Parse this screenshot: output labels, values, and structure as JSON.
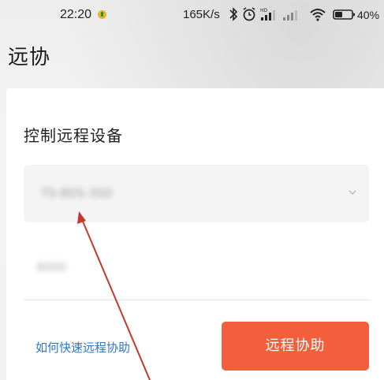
{
  "status_bar": {
    "time": "22:20",
    "net_speed": "165K/s",
    "battery": "40%"
  },
  "page": {
    "title": "远协"
  },
  "card": {
    "section_title": "控制远程设备",
    "device_select_value": "TS-8DS-3SD",
    "code_value": "9000",
    "help_link": "如何快速远程协助",
    "assist_button": "远程协助"
  },
  "colors": {
    "accent": "#f35f3c",
    "link": "#2f76c8",
    "annotation": "#c7362d"
  }
}
